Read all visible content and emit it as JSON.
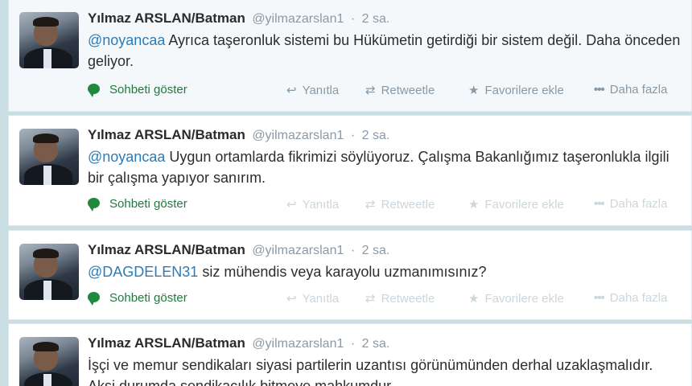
{
  "tweets": [
    {
      "name": "Yılmaz ARSLAN/Batman",
      "handle": "@yilmazarslan1",
      "time": "2 sa.",
      "mention": "@noyancaa",
      "text": " Ayrıca taşeronluk sistemi bu Hükümetin getirdiği bir sistem değil. Daha önceden geliyor."
    },
    {
      "name": "Yılmaz ARSLAN/Batman",
      "handle": "@yilmazarslan1",
      "time": "2 sa.",
      "mention": "@noyancaa",
      "text": " Uygun ortamlarda fikrimizi söylüyoruz. Çalışma Bakanlığımız taşeronlukla ilgili bir çalışma yapıyor sanırım."
    },
    {
      "name": "Yılmaz ARSLAN/Batman",
      "handle": "@yilmazarslan1",
      "time": "2 sa.",
      "mention": "@DAGDELEN31",
      "text": " siz mühendis veya karayolu uzmanımısınız?"
    },
    {
      "name": "Yılmaz ARSLAN/Batman",
      "handle": "@yilmazarslan1",
      "time": "2 sa.",
      "mention": "",
      "text": "İşçi ve memur sendikaları siyasi partilerin uzantısı görünümünden derhal uzaklaşmalıdır. Aksi durumda sendikacılık bitmeye mahkumdur."
    }
  ],
  "actions": {
    "conversation": "Sohbeti göster",
    "reply": "Yanıtla",
    "retweet": "Retweetle",
    "favorite": "Favorilere ekle",
    "more": "Daha fazla"
  },
  "icons": {
    "conversation": "speech-bubble-icon",
    "reply": "reply-arrow-icon",
    "retweet": "retweet-icon",
    "favorite": "star-icon",
    "more": "ellipsis-icon"
  },
  "colors": {
    "link": "#2b7bb9",
    "conversation": "#1f7a3e",
    "action": "#8899a6",
    "page_background": "#c9dfe4"
  }
}
